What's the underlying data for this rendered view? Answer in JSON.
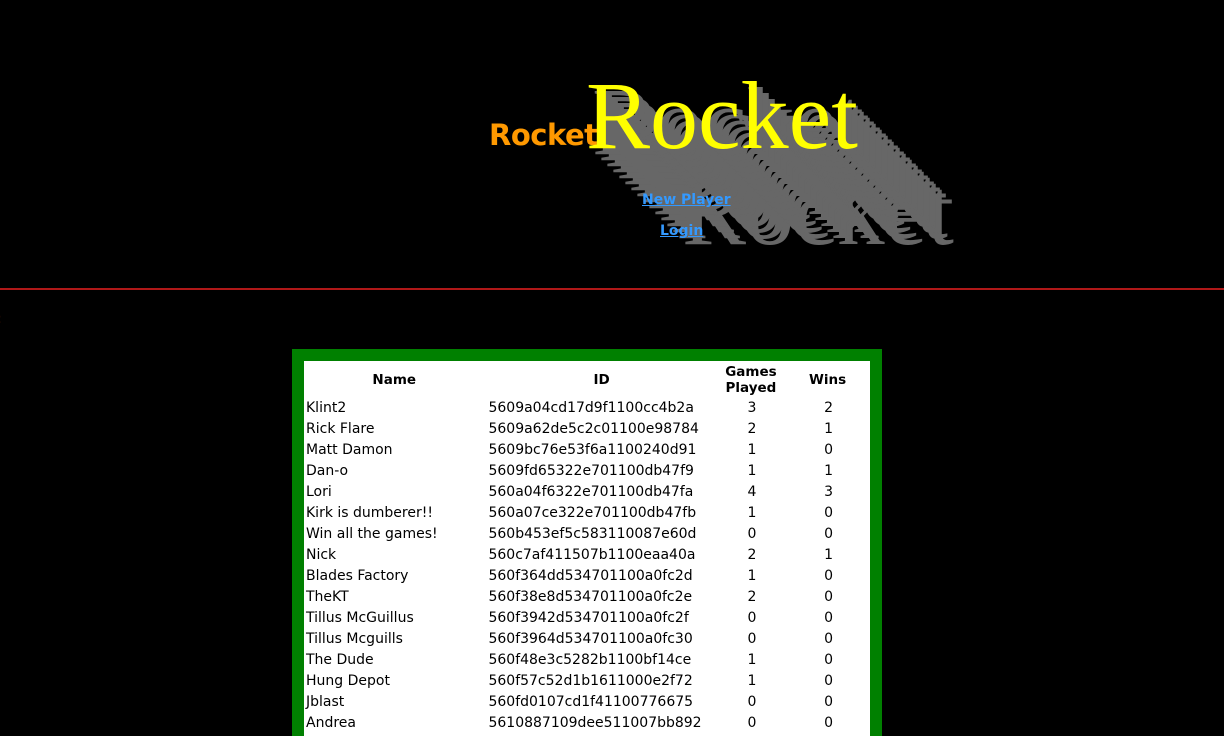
{
  "header": {
    "logo_small": "Rocket",
    "logo_big": "Rocket",
    "links": {
      "new_player": "New Player",
      "login": "Login"
    }
  },
  "colors": {
    "background": "#000000",
    "logo_small": "#ff9900",
    "logo_big": "#ffff00",
    "logo_shadow": "#676767",
    "link": "#3399ff",
    "divider": "#b01818",
    "table_border": "#008000"
  },
  "table": {
    "headers": {
      "name": "Name",
      "id": "ID",
      "games_played_line1": "Games",
      "games_played_line2": "Played",
      "wins": "Wins"
    },
    "rows": [
      {
        "name": "Klint2",
        "id": "5609a04cd17d9f1100cc4b2a",
        "games": "3",
        "wins": "2"
      },
      {
        "name": "Rick Flare",
        "id": "5609a62de5c2c01100e98784",
        "games": "2",
        "wins": "1"
      },
      {
        "name": "Matt Damon",
        "id": "5609bc76e53f6a1100240d91",
        "games": "1",
        "wins": "0"
      },
      {
        "name": "Dan-o",
        "id": "5609fd65322e701100db47f9",
        "games": "1",
        "wins": "1"
      },
      {
        "name": "Lori",
        "id": "560a04f6322e701100db47fa",
        "games": "4",
        "wins": "3"
      },
      {
        "name": "Kirk is dumberer!!",
        "id": "560a07ce322e701100db47fb",
        "games": "1",
        "wins": "0"
      },
      {
        "name": "Win all the games!",
        "id": "560b453ef5c583110087e60d",
        "games": "0",
        "wins": "0"
      },
      {
        "name": "Nick",
        "id": "560c7af411507b1100eaa40a",
        "games": "2",
        "wins": "1"
      },
      {
        "name": "Blades Factory",
        "id": "560f364dd534701100a0fc2d",
        "games": "1",
        "wins": "0"
      },
      {
        "name": "TheKT",
        "id": "560f38e8d534701100a0fc2e",
        "games": "2",
        "wins": "0"
      },
      {
        "name": "Tillus McGuillus",
        "id": "560f3942d534701100a0fc2f",
        "games": "0",
        "wins": "0"
      },
      {
        "name": "Tillus Mcguills",
        "id": "560f3964d534701100a0fc30",
        "games": "0",
        "wins": "0"
      },
      {
        "name": "The Dude",
        "id": "560f48e3c5282b1100bf14ce",
        "games": "1",
        "wins": "0"
      },
      {
        "name": "Hung Depot",
        "id": "560f57c52d1b1611000e2f72",
        "games": "1",
        "wins": "0"
      },
      {
        "name": "Jblast",
        "id": "560fd0107cd1f41100776675",
        "games": "0",
        "wins": "0"
      },
      {
        "name": "Andrea",
        "id": "5610887109dee511007bb892",
        "games": "0",
        "wins": "0"
      }
    ]
  }
}
